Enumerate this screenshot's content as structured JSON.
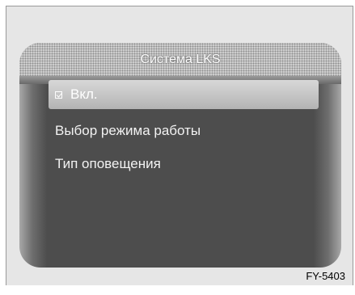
{
  "screen": {
    "title": "Система LKS",
    "items": [
      {
        "label": "Вкл.",
        "checked": true,
        "selected": true
      },
      {
        "label": "Выбор режима работы"
      },
      {
        "label": "Тип оповещения"
      }
    ]
  },
  "figure_code": "FY-5403"
}
